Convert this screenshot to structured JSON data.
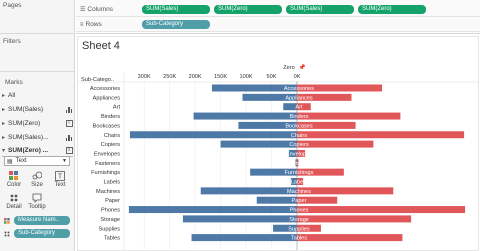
{
  "sidebar": {
    "pages_title": "Pages",
    "filters_title": "Filters",
    "marks_title": "Marks",
    "marks_items": [
      {
        "label": "All",
        "kind": "none"
      },
      {
        "label": "SUM(Sales)",
        "kind": "bar"
      },
      {
        "label": "SUM(Zero)",
        "kind": "text"
      },
      {
        "label": "SUM(Sales)...",
        "kind": "bar"
      },
      {
        "label": "SUM(Zero) ...",
        "kind": "text"
      }
    ],
    "mark_type": "Text",
    "cards": [
      "Color",
      "Size",
      "Text",
      "Detail",
      "Tooltip"
    ],
    "pills": [
      "Measure Nam..",
      "Sub-Category"
    ]
  },
  "shelves": {
    "columns_label": "Columns",
    "rows_label": "Rows",
    "columns_pills": [
      "SUM(Sales)",
      "SUM(Zero)",
      "SUM(Sales)",
      "SUM(Zero)"
    ],
    "rows_pill": "Sub-Category"
  },
  "sheet": {
    "title": "Sheet 4",
    "axis_title": "Zero",
    "row_header": "Sub-Catego.."
  },
  "colors": {
    "blue": "#4e79a7",
    "red": "#e15759",
    "teal": "#4f9ea8",
    "green": "#15a36b"
  },
  "chart_data": {
    "type": "bar",
    "orientation": "horizontal-diverging",
    "axis_title": "Zero",
    "x_tick_labels": [
      "300K",
      "250K",
      "200K",
      "150K",
      "100K",
      "50K",
      "0K"
    ],
    "xlim": [
      0,
      350000
    ],
    "categories": [
      "Accessories",
      "Appliances",
      "Art",
      "Binders",
      "Bookcases",
      "Chairs",
      "Copiers",
      "Envelopes",
      "Fasteners",
      "Furnishings",
      "Labels",
      "Machines",
      "Paper",
      "Phones",
      "Storage",
      "Supplies",
      "Tables"
    ],
    "series": [
      {
        "values": [
          167000,
          107000,
          27000,
          203000,
          115000,
          328000,
          150000,
          16000,
          3000,
          92000,
          12000,
          189000,
          79000,
          330000,
          224000,
          47000,
          207000
        ]
      },
      {
        "values": [
          167000,
          107000,
          27000,
          203000,
          115000,
          328000,
          150000,
          16000,
          3000,
          92000,
          12000,
          189000,
          79000,
          330000,
          224000,
          47000,
          207000
        ]
      }
    ]
  }
}
